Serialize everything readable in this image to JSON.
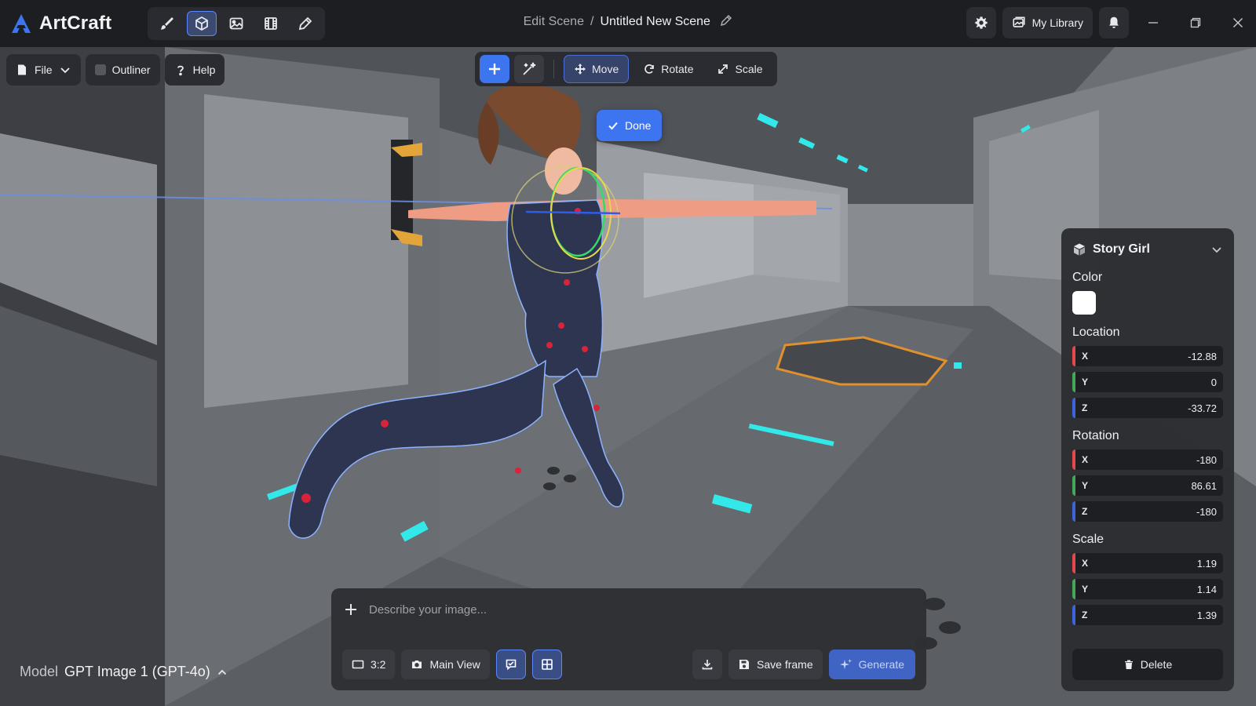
{
  "app": {
    "name": "ArtCraft"
  },
  "breadcrumb": {
    "parent": "Edit Scene",
    "separator": "/",
    "current": "Untitled New Scene"
  },
  "mode_toolbar": {
    "items": [
      "brush-icon",
      "cube-icon",
      "image-icon",
      "film-icon",
      "pen-icon"
    ],
    "active_index": 1
  },
  "header_right": {
    "library_label": "My Library"
  },
  "file_bar": {
    "file_label": "File",
    "outliner_label": "Outliner",
    "help_label": "Help"
  },
  "transform": {
    "move_label": "Move",
    "rotate_label": "Rotate",
    "scale_label": "Scale",
    "active": "Move"
  },
  "done_label": "Done",
  "properties": {
    "object_name": "Story Girl",
    "color_label": "Color",
    "color_value": "#ffffff",
    "location_label": "Location",
    "location": {
      "x": "-12.88",
      "y": "0",
      "z": "-33.72"
    },
    "rotation_label": "Rotation",
    "rotation": {
      "x": "-180",
      "y": "86.61",
      "z": "-180"
    },
    "scale_label": "Scale",
    "scale": {
      "x": "1.19",
      "y": "1.14",
      "z": "1.39"
    },
    "axis_labels": {
      "x": "X",
      "y": "Y",
      "z": "Z"
    },
    "axis_colors": {
      "x": "#e5484d",
      "y": "#46a758",
      "z": "#3e63dd"
    },
    "delete_label": "Delete"
  },
  "prompt": {
    "placeholder": "Describe your image...",
    "aspect_label": "3:2",
    "camera_label": "Main View",
    "save_frame_label": "Save frame",
    "generate_label": "Generate"
  },
  "model": {
    "label": "Model",
    "value": "GPT Image 1 (GPT-4o)"
  },
  "colors": {
    "accent": "#3d74f0",
    "background": "#1d1e22"
  }
}
